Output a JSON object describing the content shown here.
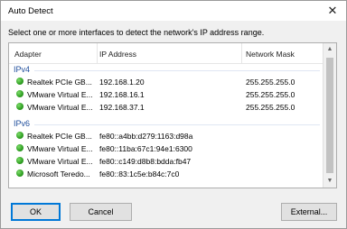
{
  "window": {
    "title": "Auto Detect",
    "close_glyph": "✕"
  },
  "instruction": "Select one or more interfaces to detect the network's IP address  range.",
  "list": {
    "columns": [
      "Adapter",
      "IP Address",
      "Network Mask"
    ],
    "groups": [
      {
        "label": "IPv4",
        "rows": [
          {
            "adapter": "Realtek PCIe GB...",
            "ip": "192.168.1.20",
            "mask": "255.255.255.0"
          },
          {
            "adapter": "VMware Virtual E...",
            "ip": "192.168.16.1",
            "mask": "255.255.255.0"
          },
          {
            "adapter": "VMware Virtual E...",
            "ip": "192.168.37.1",
            "mask": "255.255.255.0"
          }
        ]
      },
      {
        "label": "IPv6",
        "rows": [
          {
            "adapter": "Realtek PCIe GB...",
            "ip": "fe80::a4bb:d279:1163:d98a",
            "mask": ""
          },
          {
            "adapter": "VMware Virtual E...",
            "ip": "fe80::11ba:67c1:94e1:6300",
            "mask": ""
          },
          {
            "adapter": "VMware Virtual E...",
            "ip": "fe80::c149:d8b8:bdda:fb47",
            "mask": ""
          },
          {
            "adapter": "Microsoft Teredo...",
            "ip": "fe80::83:1c5e:b84c:7c0",
            "mask": ""
          }
        ]
      }
    ],
    "status_color": "#2f9e22"
  },
  "buttons": {
    "ok": "OK",
    "cancel": "Cancel",
    "external": "External..."
  }
}
